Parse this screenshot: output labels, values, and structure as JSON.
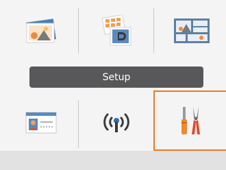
{
  "menu": {
    "selected_label": "Setup",
    "selected_item": "setup"
  },
  "colors": {
    "background": "#f4f4f4",
    "label_bar": "#58585a",
    "selection_border": "#e87a22",
    "divider": "#c8c8c8",
    "bottom_strip": "#e2e2e2"
  },
  "icons": [
    "print-photo-icon",
    "photo-layout-icon",
    "photo-collage-icon",
    "id-photo-icon",
    "wireless-icon",
    "setup-tools-icon"
  ]
}
